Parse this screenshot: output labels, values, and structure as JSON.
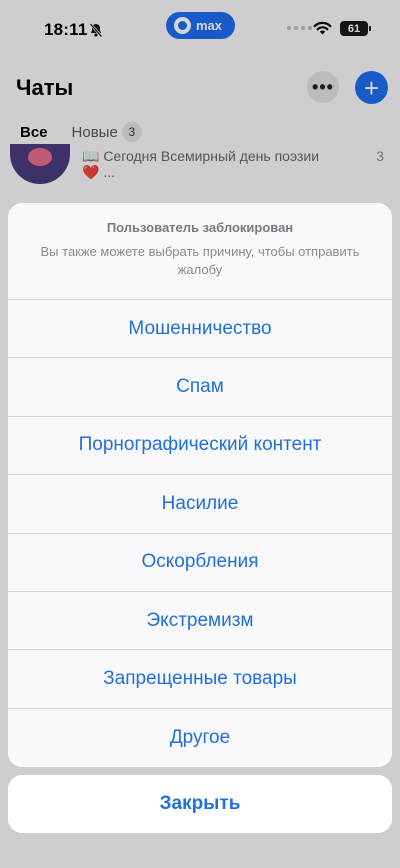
{
  "status_bar": {
    "time": "18:11",
    "app_pill": "max",
    "battery": "61"
  },
  "header": {
    "title": "Чаты",
    "more_label": "•••",
    "add_label": "+"
  },
  "tabs": [
    {
      "label": "Все",
      "active": true
    },
    {
      "label": "Новые",
      "badge": "3",
      "active": false
    }
  ],
  "chat_preview": {
    "line1": "📖 Сегодня Всемирный день поэзии",
    "line2": "❤️ ...",
    "count": "3"
  },
  "action_sheet": {
    "title": "Пользователь заблокирован",
    "message": "Вы также можете выбрать причину, чтобы отправить жалобу",
    "options": [
      "Мошенничество",
      "Спам",
      "Порнографический контент",
      "Насилие",
      "Оскорбления",
      "Экстремизм",
      "Запрещенные товары",
      "Другое"
    ],
    "close_label": "Закрыть"
  },
  "colors": {
    "accent": "#1f6fdc",
    "brand": "#1e6cf0"
  }
}
